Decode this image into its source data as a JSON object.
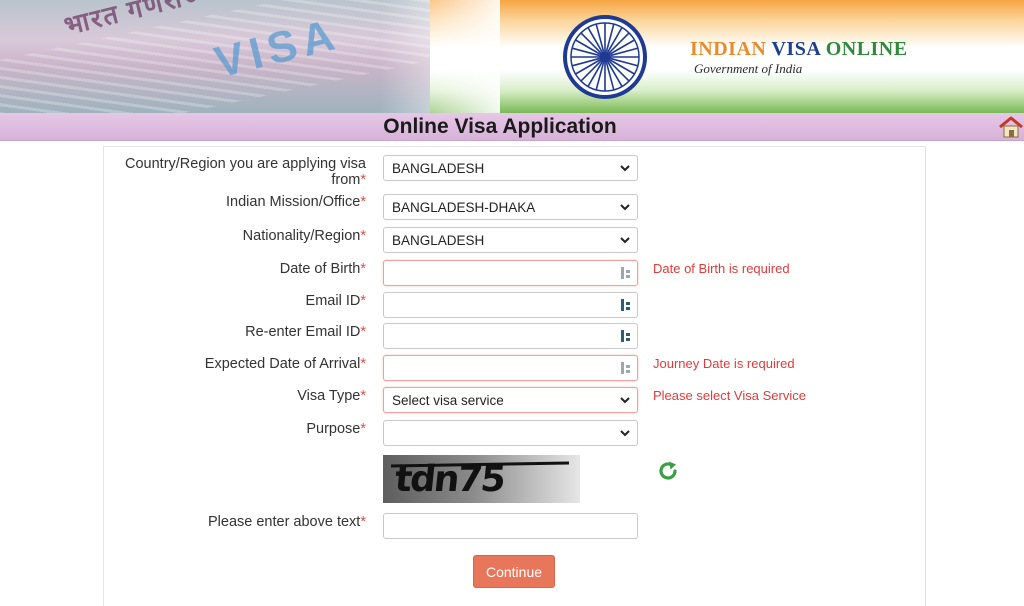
{
  "header": {
    "brand": {
      "word1": "INDIAN",
      "word2": "VISA",
      "word3": "ONLINE"
    },
    "subtitle": "Government of India",
    "passport_text": "भारत गणराज्य REPUBLIC OF INDIA",
    "stamp_text": "VISA"
  },
  "titlebar": {
    "title": "Online Visa Application",
    "home_icon": "home-icon"
  },
  "form": {
    "country": {
      "label": "Country/Region you are applying visa",
      "label2": "from",
      "value": "BANGLADESH"
    },
    "mission": {
      "label": "Indian Mission/Office",
      "value": "BANGLADESH-DHAKA"
    },
    "nationality": {
      "label": "Nationality/Region",
      "value": "BANGLADESH"
    },
    "dob": {
      "label": "Date of Birth",
      "value": "",
      "error": "Date of Birth is required"
    },
    "email": {
      "label": "Email ID",
      "value": ""
    },
    "email2": {
      "label": "Re-enter Email ID",
      "value": ""
    },
    "arrival": {
      "label": "Expected Date of Arrival",
      "value": "",
      "error": "Journey Date is required"
    },
    "visa_type": {
      "label": "Visa Type",
      "value": "Select visa service",
      "error": "Please select Visa Service"
    },
    "purpose": {
      "label": "Purpose",
      "value": ""
    },
    "captcha": {
      "text": "tdn75",
      "input_label": "Please enter above text",
      "value": ""
    },
    "required_mark": "*",
    "continue_label": "Continue"
  },
  "colors": {
    "accent": "#e8765a",
    "error": "#e03b3b",
    "titlebar": "#dcb8dc"
  }
}
